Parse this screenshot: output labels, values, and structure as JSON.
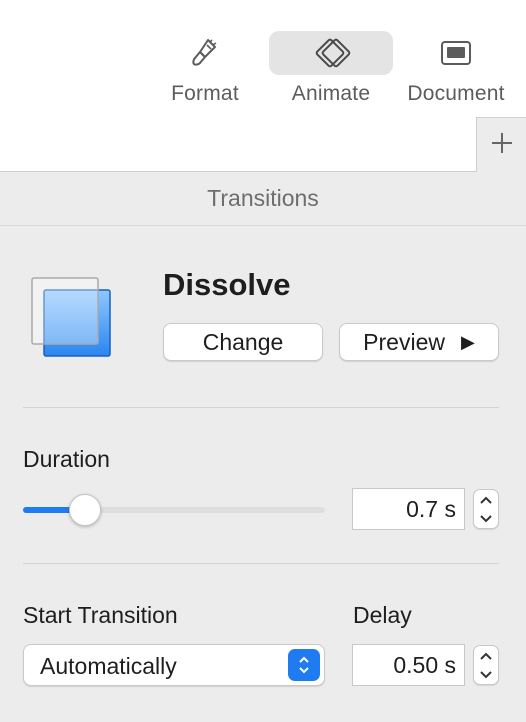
{
  "toolbar": {
    "format_label": "Format",
    "animate_label": "Animate",
    "document_label": "Document",
    "active_tab": "Animate"
  },
  "icons": {
    "format": "paintbrush-icon",
    "animate": "diamond-animate-icon",
    "document": "document-slide-icon",
    "add": "plus-icon",
    "play": "play-triangle-icon",
    "stepper": "chevron-up-down-icon"
  },
  "add_tab_label": "+",
  "section": {
    "title": "Transitions"
  },
  "effect": {
    "name": "Dissolve",
    "change_label": "Change",
    "preview_label": "Preview",
    "preview_glyph": "▶"
  },
  "duration": {
    "label": "Duration",
    "value": "0.7 s",
    "slider_fraction": 0.17
  },
  "start": {
    "label": "Start Transition",
    "selected": "Automatically"
  },
  "delay": {
    "label": "Delay",
    "value": "0.50 s"
  },
  "colors": {
    "accent": "#1e7bf2",
    "thumb_front": "#4aa3f5",
    "panel_bg": "#ececec"
  }
}
